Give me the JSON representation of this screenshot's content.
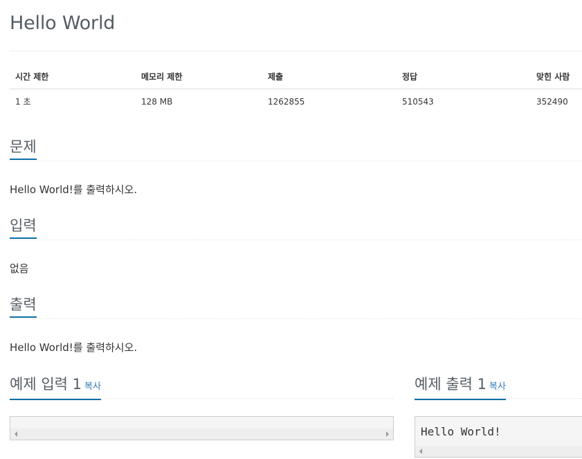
{
  "problem": {
    "title": "Hello World"
  },
  "stats": {
    "headers": [
      "시간 제한",
      "메모리 제한",
      "제출",
      "정답",
      "맞힌 사람"
    ],
    "values": [
      "1 초",
      "128 MB",
      "1262855",
      "510543",
      "352490"
    ]
  },
  "sections": {
    "problem": {
      "heading": "문제",
      "body": "Hello World!를 출력하시오."
    },
    "input": {
      "heading": "입력",
      "body": "없음"
    },
    "output": {
      "heading": "출력",
      "body": "Hello World!를 출력하시오."
    }
  },
  "samples": {
    "input": {
      "heading": "예제 입력 1",
      "copy_label": "복사",
      "content": ""
    },
    "output": {
      "heading": "예제 출력 1",
      "copy_label": "복사",
      "content": "Hello World!"
    }
  },
  "colors": {
    "accent": "#0b6ea8",
    "link": "#337ab7"
  }
}
